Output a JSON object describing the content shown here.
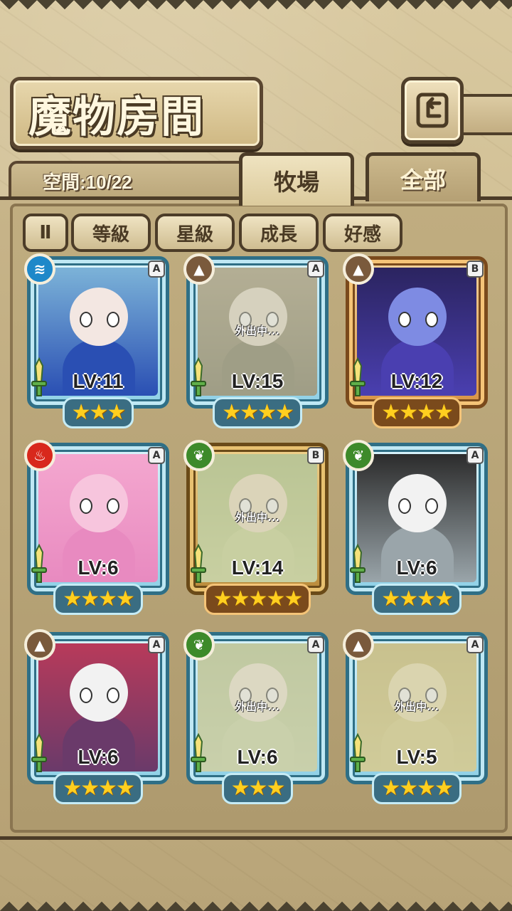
{
  "header": {
    "title": "魔物房間",
    "back_icon": "return-arrow-icon"
  },
  "space": {
    "label": "空間:10/22"
  },
  "tabs": [
    {
      "label": "牧場",
      "active": true
    },
    {
      "label": "全部",
      "active": false
    }
  ],
  "sort": {
    "toggle_label": "Ⅱ",
    "buttons": [
      {
        "label": "等級"
      },
      {
        "label": "星級"
      },
      {
        "label": "成長"
      },
      {
        "label": "好感"
      }
    ]
  },
  "away_label": "外出中...",
  "monsters": [
    {
      "level": "LV:11",
      "stars": 3,
      "rank": "A",
      "element": "water",
      "frame": "a",
      "away": false,
      "stars_text": "★★★"
    },
    {
      "level": "LV:15",
      "stars": 4,
      "rank": "A",
      "element": "earth",
      "frame": "a",
      "away": true,
      "stars_text": "★★★★"
    },
    {
      "level": "LV:12",
      "stars": 4,
      "rank": "B",
      "element": "earth",
      "frame": "b",
      "away": false,
      "stars_text": "★★★★"
    },
    {
      "level": "LV:6",
      "stars": 4,
      "rank": "A",
      "element": "fire",
      "frame": "a",
      "away": false,
      "stars_text": "★★★★"
    },
    {
      "level": "LV:14",
      "stars": 5,
      "rank": "B",
      "element": "wood",
      "frame": "gold",
      "away": true,
      "stars_text": "★★★★★"
    },
    {
      "level": "LV:6",
      "stars": 4,
      "rank": "A",
      "element": "wood",
      "frame": "a",
      "away": false,
      "stars_text": "★★★★"
    },
    {
      "level": "LV:6",
      "stars": 4,
      "rank": "A",
      "element": "earth",
      "frame": "a",
      "away": false,
      "stars_text": "★★★★"
    },
    {
      "level": "LV:6",
      "stars": 3,
      "rank": "A",
      "element": "wood",
      "frame": "a",
      "away": true,
      "stars_text": "★★★"
    },
    {
      "level": "LV:5",
      "stars": 4,
      "rank": "A",
      "element": "earth",
      "frame": "a",
      "away": true,
      "stars_text": "★★★★"
    }
  ],
  "colors": {
    "water": "#1e88c9",
    "earth": "#7a5a3c",
    "fire": "#d8281c",
    "wood": "#3d8a2a",
    "frame_a": "#8fd0e6",
    "frame_b": "#d99446",
    "star": "#ffcf1f"
  }
}
